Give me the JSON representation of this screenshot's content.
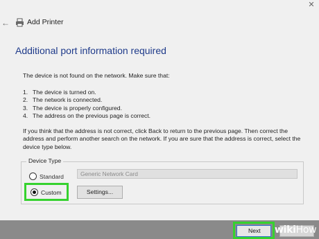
{
  "window": {
    "title": "Add Printer",
    "back_icon": "back-arrow-icon",
    "printer_icon": "printer-icon"
  },
  "page": {
    "heading": "Additional port information required",
    "intro": "The device is not found on the network. Make sure that:",
    "checklist": [
      {
        "num": "1.",
        "text": "The device is turned on."
      },
      {
        "num": "2.",
        "text": "The network is connected."
      },
      {
        "num": "3.",
        "text": "The device is properly configured."
      },
      {
        "num": "4.",
        "text": "The address on the previous page is correct."
      }
    ],
    "instructions": "If you think that the address is not correct, click Back to return to the previous page. Then correct the address and perform another search on the network. If you are sure that the address is correct, select the device type below."
  },
  "device_type": {
    "legend": "Device Type",
    "standard_label": "Standard",
    "standard_selected": false,
    "standard_value": "Generic Network Card",
    "custom_label": "Custom",
    "custom_selected": true,
    "settings_label": "Settings..."
  },
  "footer": {
    "next_label": "Next",
    "watermark_a": "wiki",
    "watermark_b": "How"
  },
  "colors": {
    "heading": "#1e3a8a",
    "highlight": "#35d22e",
    "focus_border": "#2f6fd1"
  }
}
